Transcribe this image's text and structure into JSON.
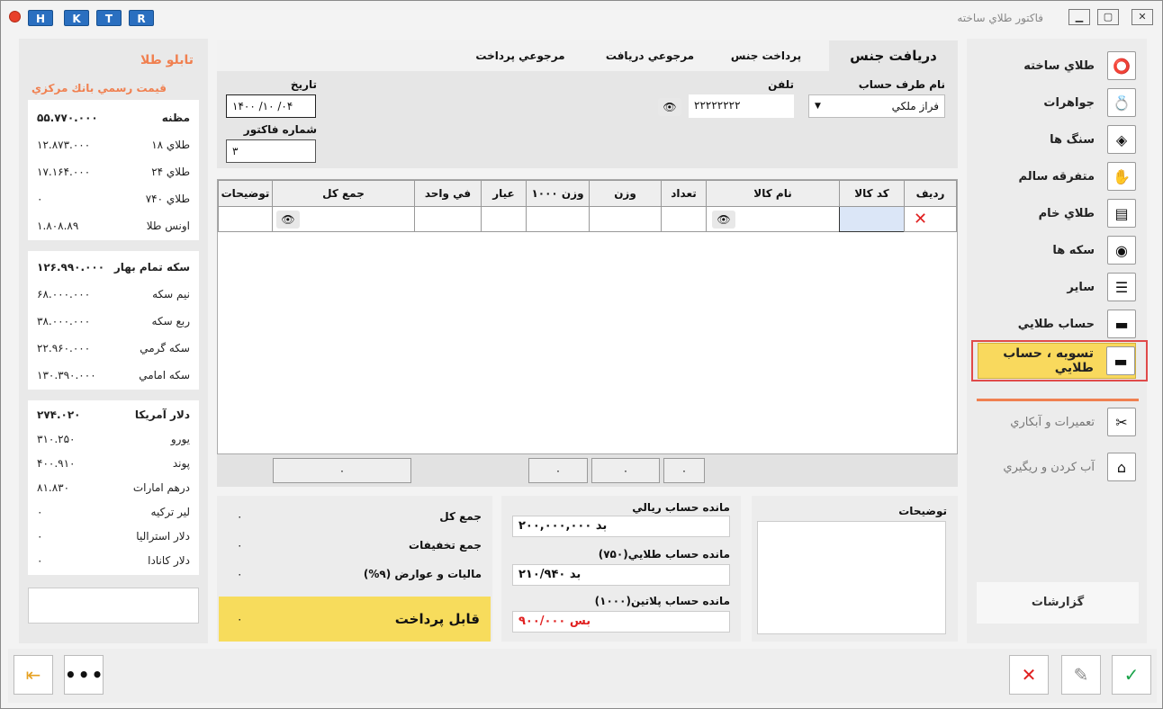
{
  "window": {
    "title": "فاكتور طلاي ساخته",
    "letters": [
      "H",
      "K",
      "T",
      "R"
    ]
  },
  "tabs": [
    {
      "label": "دريافت جنس",
      "active": true
    },
    {
      "label": "پرداخت جنس"
    },
    {
      "label": "مرجوعي دريافت"
    },
    {
      "label": "مرجوعي پرداخت"
    }
  ],
  "form": {
    "account_label": "نام طرف حساب",
    "account_value": "فراز ملكي",
    "phone_label": "تلفن",
    "phone_value": "۲۲۲۲۲۲۲۲",
    "date_label": "تاريخ",
    "date_value": "۱۴۰۰ /۱۰ /۰۴",
    "invoice_label": "شماره فاكتور",
    "invoice_value": "۳"
  },
  "grid": {
    "columns": [
      "رديف",
      "كد كالا",
      "نام كالا",
      "تعداد",
      "وزن",
      "وزن ۱۰۰۰",
      "عيار",
      "في واحد",
      "جمع كل",
      "توضيحات"
    ]
  },
  "sums": [
    "۰",
    "۰",
    "۰",
    "۰"
  ],
  "totals": {
    "total_label": "جمع كل",
    "total_value": "۰",
    "discount_label": "جمع تخفيفات",
    "discount_value": "۰",
    "tax_label": "ماليات و عوارض (۹%)",
    "tax_value": "۰",
    "payable_label": "قابل پرداخت",
    "payable_value": "۰"
  },
  "balances": {
    "rial_label": "مانده حساب ريالي",
    "rial_value": "۲۰۰,۰۰۰,۰۰۰ بد",
    "gold_label": "مانده حساب طلايي(۷۵۰)",
    "gold_value": "۲۱۰/۹۴۰ بد",
    "platinum_label": "مانده حساب پلاتين(۱۰۰۰)",
    "platinum_value": "۹۰۰/۰۰۰ بس"
  },
  "notes": {
    "label": "توضيحات"
  },
  "rail": [
    {
      "label": "طلاي ساخته",
      "icon": "ring-icon"
    },
    {
      "label": "جواهرات",
      "icon": "jewel-icon"
    },
    {
      "label": "سنگ ها",
      "icon": "gem-icon"
    },
    {
      "label": "متفرقه سالم",
      "icon": "hand-icon"
    },
    {
      "label": "طلاي خام",
      "icon": "gold-bar-icon"
    },
    {
      "label": "سكه ها",
      "icon": "coin-icon"
    },
    {
      "label": "ساير",
      "icon": "list-icon"
    },
    {
      "label": "حساب طلايي",
      "icon": "wallet-icon"
    },
    {
      "label": "تسويه ، حساب طلايي",
      "icon": "wallet-icon",
      "active": true
    },
    {
      "label": "تعميرات و آبكاري",
      "icon": "tools-icon"
    },
    {
      "label": "آب كردن و ريگيري",
      "icon": "melt-icon"
    }
  ],
  "reports_label": "گزارشات",
  "board": {
    "title": "تابلو طلا",
    "subtitle": "قيمت رسمي بانك مركزي",
    "group1": [
      {
        "name": "مظنه",
        "value": "۵۵.۷۷۰.۰۰۰"
      },
      {
        "name": "طلاي ۱۸",
        "value": "۱۲.۸۷۳.۰۰۰"
      },
      {
        "name": "طلاي ۲۴",
        "value": "۱۷.۱۶۴.۰۰۰"
      },
      {
        "name": "طلاي ۷۴۰",
        "value": "۰"
      },
      {
        "name": "اونس طلا",
        "value": "۱.۸۰۸.۸۹"
      }
    ],
    "group2": [
      {
        "name": "سكه تمام بهار",
        "value": "۱۲۶.۹۹۰.۰۰۰"
      },
      {
        "name": "نيم سكه",
        "value": "۶۸.۰۰۰.۰۰۰"
      },
      {
        "name": "ربع سكه",
        "value": "۳۸.۰۰۰.۰۰۰"
      },
      {
        "name": "سكه گرمي",
        "value": "۲۲.۹۶۰.۰۰۰"
      },
      {
        "name": "سكه امامي",
        "value": "۱۳۰.۳۹۰.۰۰۰"
      }
    ],
    "group3": [
      {
        "name": "دلار آمريكا",
        "value": "۲۷۴.۰۲۰"
      },
      {
        "name": "يورو",
        "value": "۳۱۰.۲۵۰"
      },
      {
        "name": "پوند",
        "value": "۴۰۰.۹۱۰"
      },
      {
        "name": "درهم امارات",
        "value": "۸۱.۸۳۰"
      },
      {
        "name": "لير تركيه",
        "value": "۰"
      },
      {
        "name": "دلار استراليا",
        "value": "۰"
      },
      {
        "name": "دلار كانادا",
        "value": "۰"
      }
    ]
  },
  "colors": {
    "accent": "#f08050",
    "highlight": "#f7dc5c",
    "danger": "#e02020",
    "confirm": "#1aa34a"
  }
}
